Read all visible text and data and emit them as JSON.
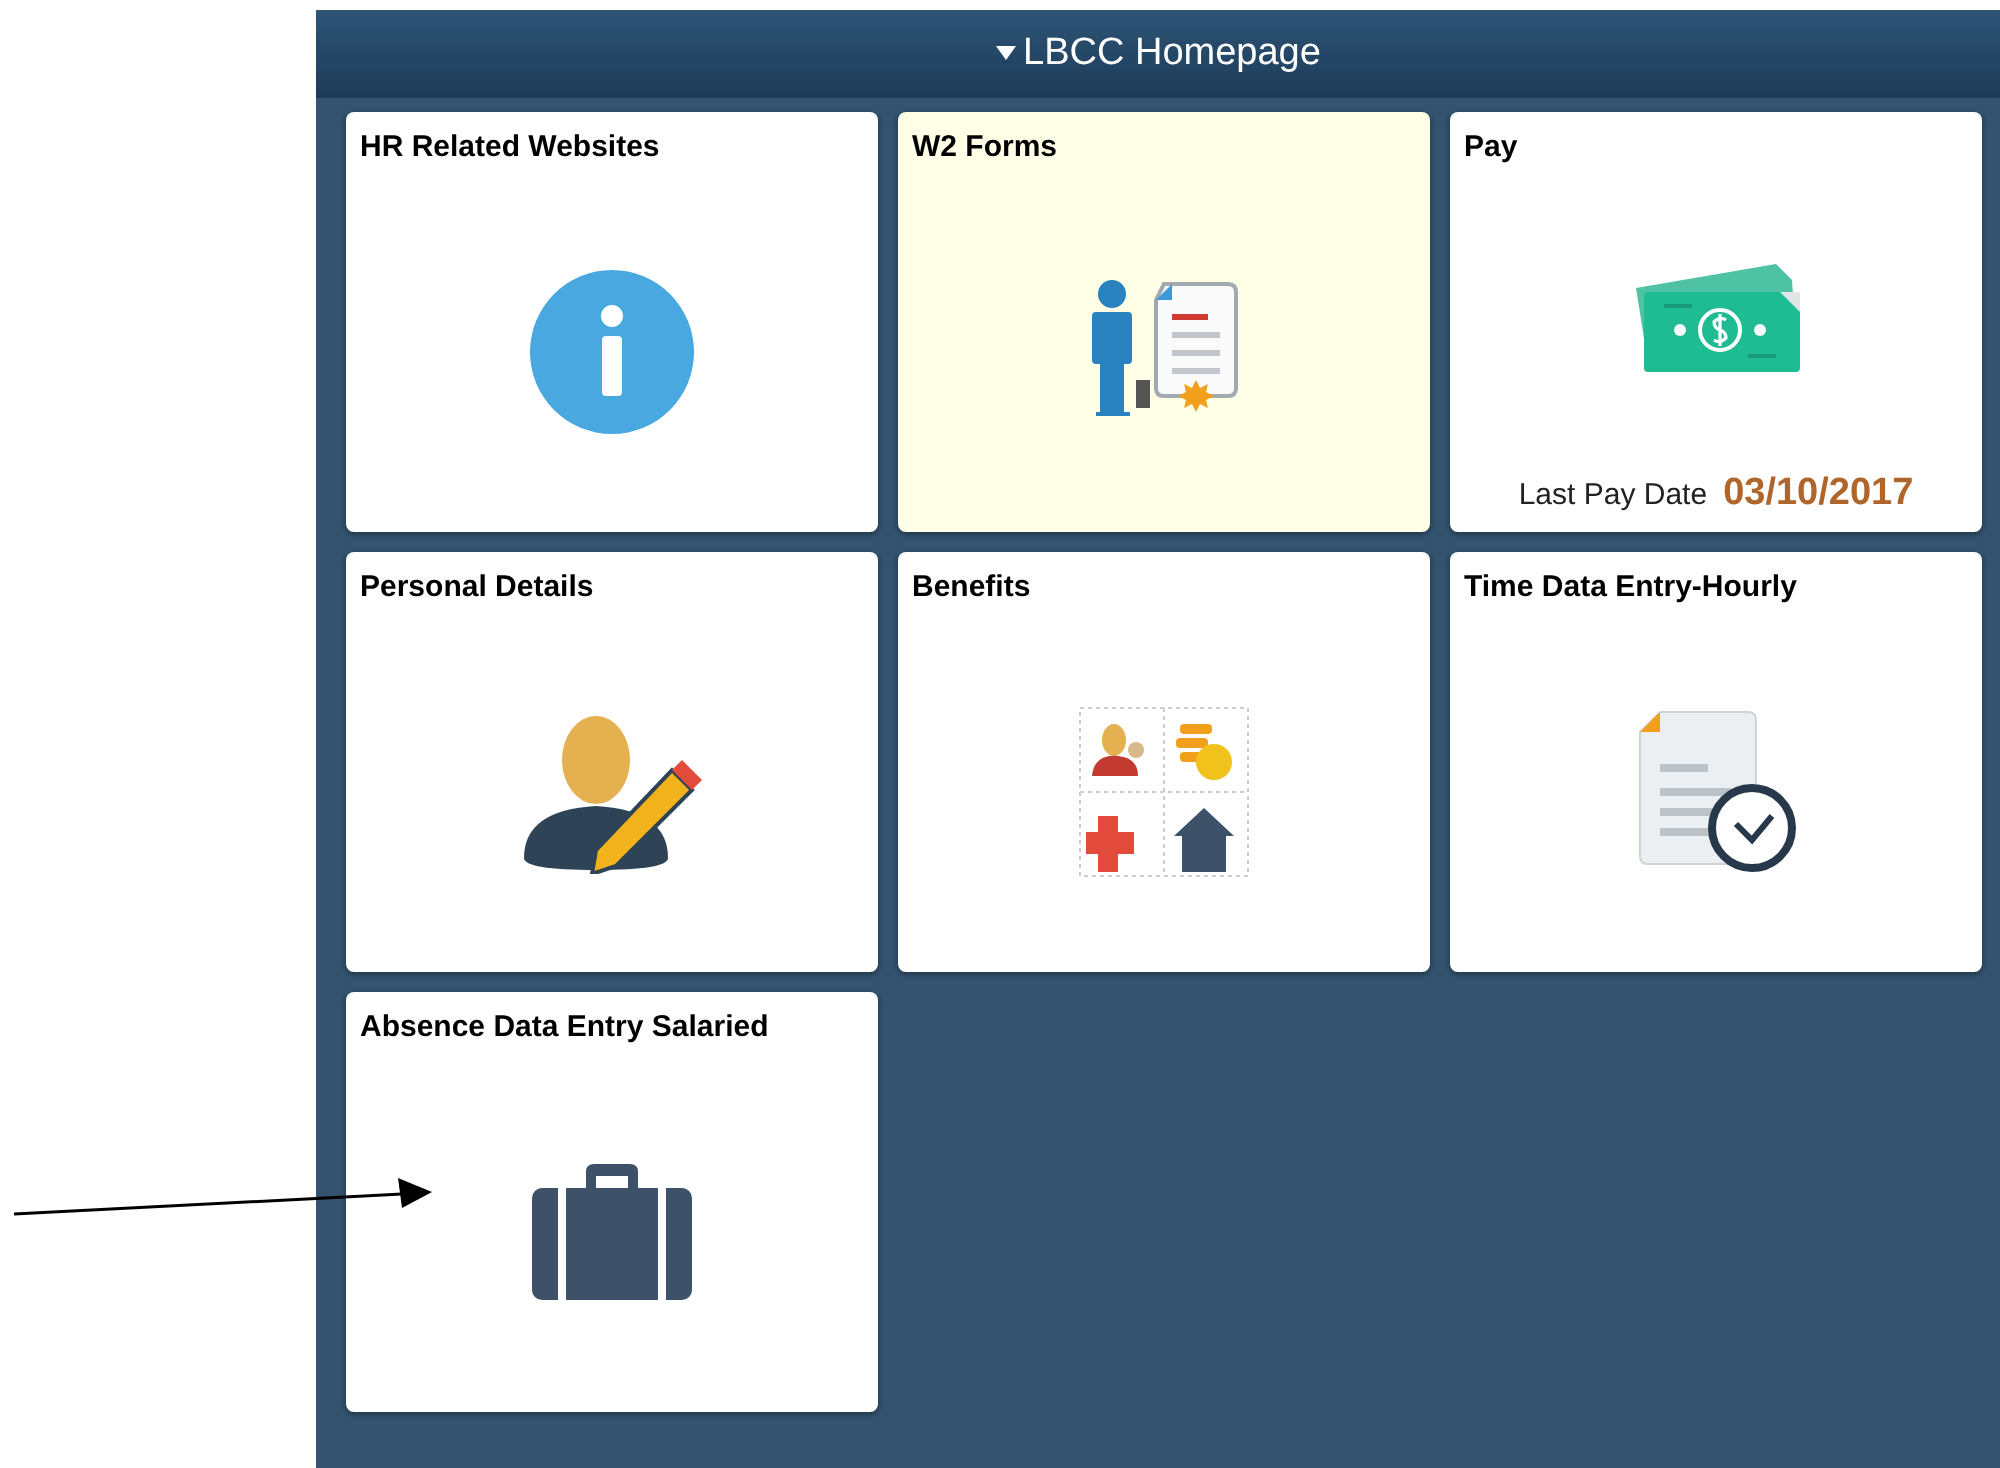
{
  "header": {
    "title": "LBCC Homepage"
  },
  "tiles": [
    {
      "title": "HR Related Websites",
      "highlighted": false
    },
    {
      "title": "W2 Forms",
      "highlighted": true
    },
    {
      "title": "Pay",
      "highlighted": false,
      "footer": {
        "label": "Last Pay Date",
        "value": "03/10/2017"
      }
    },
    {
      "title": "Personal Details",
      "highlighted": false
    },
    {
      "title": "Benefits",
      "highlighted": false
    },
    {
      "title": "Time Data Entry-Hourly",
      "highlighted": false
    },
    {
      "title": "Absence Data Entry Salaried",
      "highlighted": false
    }
  ]
}
